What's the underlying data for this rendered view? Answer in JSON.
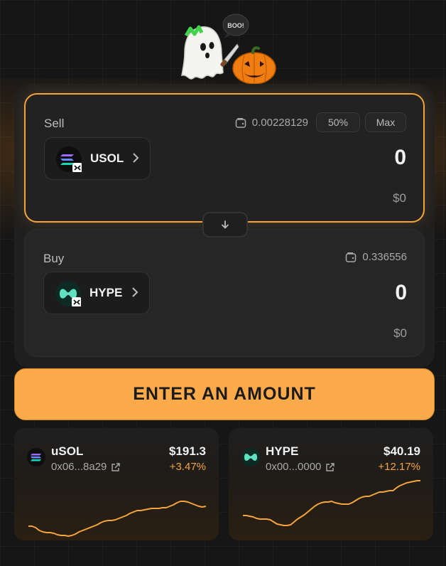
{
  "mascot": {
    "speech": "BOO!"
  },
  "sell": {
    "label": "Sell",
    "balance": "0.00228129",
    "half_label": "50%",
    "max_label": "Max",
    "token": "USOL",
    "amount": "0",
    "usd": "$0"
  },
  "buy": {
    "label": "Buy",
    "balance": "0.336556",
    "token": "HYPE",
    "amount": "0",
    "usd": "$0"
  },
  "cta_label": "ENTER AN AMOUNT",
  "markets": [
    {
      "name": "uSOL",
      "address": "0x06...8a29",
      "price": "$191.3",
      "change": "+3.47%",
      "spark": [
        68,
        68,
        70,
        74,
        76,
        77,
        77,
        78,
        80,
        81,
        81,
        82,
        81,
        79,
        76,
        74,
        72,
        70,
        68,
        66,
        63,
        61,
        60,
        60,
        59,
        57,
        55,
        53,
        50,
        48,
        46,
        46,
        45,
        44,
        43,
        43,
        43,
        42,
        42,
        40,
        38,
        35,
        33,
        33,
        34,
        36,
        38,
        40,
        41,
        40
      ]
    },
    {
      "name": "HYPE",
      "address": "0x00...0000",
      "price": "$40.19",
      "change": "+12.17%",
      "spark": [
        53,
        53,
        54,
        55,
        57,
        58,
        58,
        58,
        59,
        62,
        65,
        66,
        67,
        67,
        66,
        62,
        58,
        55,
        52,
        48,
        44,
        40,
        37,
        35,
        34,
        34,
        33,
        35,
        36,
        37,
        37,
        37,
        35,
        32,
        29,
        27,
        26,
        26,
        24,
        22,
        20,
        20,
        19,
        18,
        18,
        14,
        11,
        9,
        7,
        6,
        5,
        4,
        4
      ]
    }
  ],
  "colors": {
    "accent": "#f5a43a",
    "cta": "#fdab4a",
    "usol": "#9b6bff",
    "hype": "#5fe0c0"
  }
}
